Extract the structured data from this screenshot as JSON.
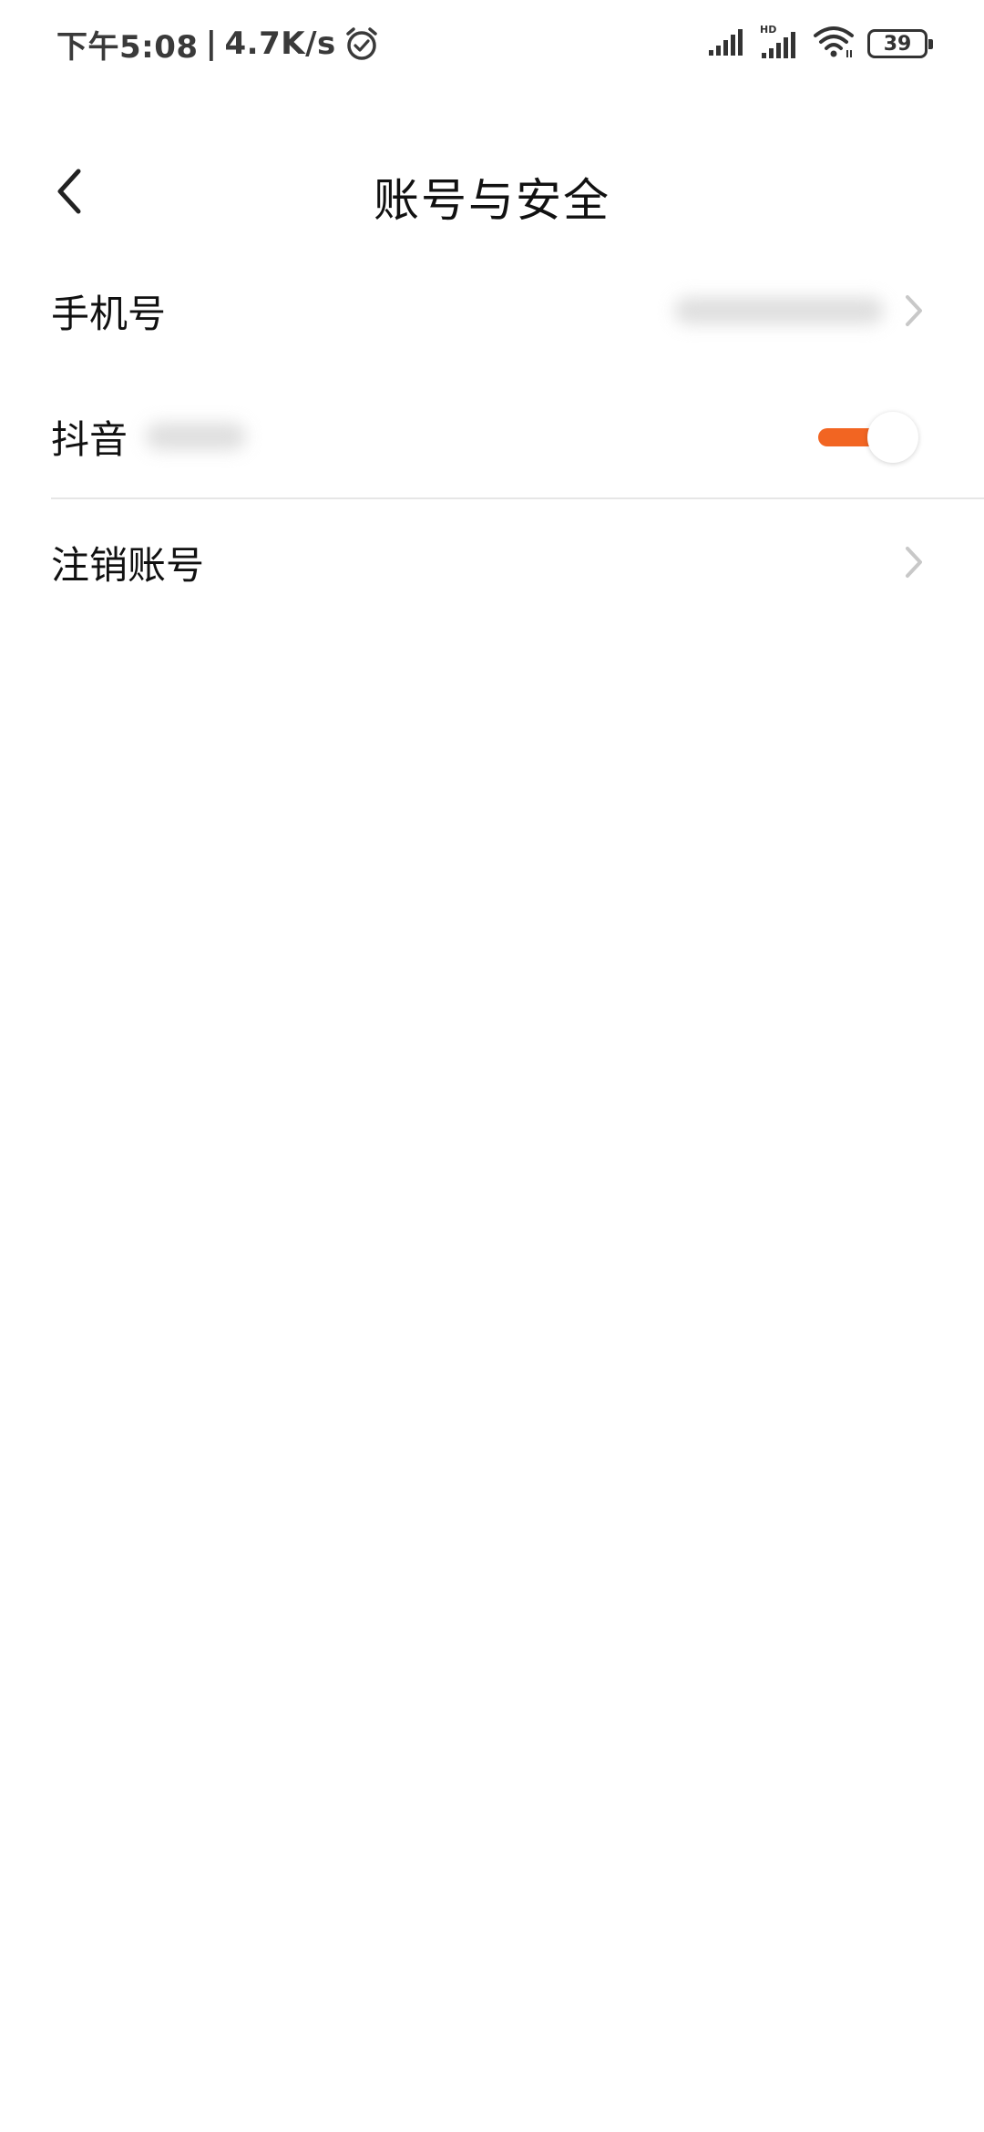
{
  "status_bar": {
    "time": "下午5:08",
    "separator": "|",
    "net_speed": "4.7K/s",
    "battery": "39",
    "icons": [
      "alarm-icon",
      "signal-icon",
      "hd-signal-icon",
      "wifi-icon",
      "battery-icon"
    ]
  },
  "header": {
    "title": "账号与安全",
    "back_icon": "chevron-left-icon"
  },
  "settings": {
    "phone_label": "手机号",
    "douyin_label": "抖音",
    "douyin_toggle_on": true,
    "deactivate_label": "注销账号"
  },
  "colors": {
    "accent": "#f26522",
    "background": "#ffffff",
    "divider": "#e6e6e6",
    "chevron": "#c8c8c8"
  }
}
